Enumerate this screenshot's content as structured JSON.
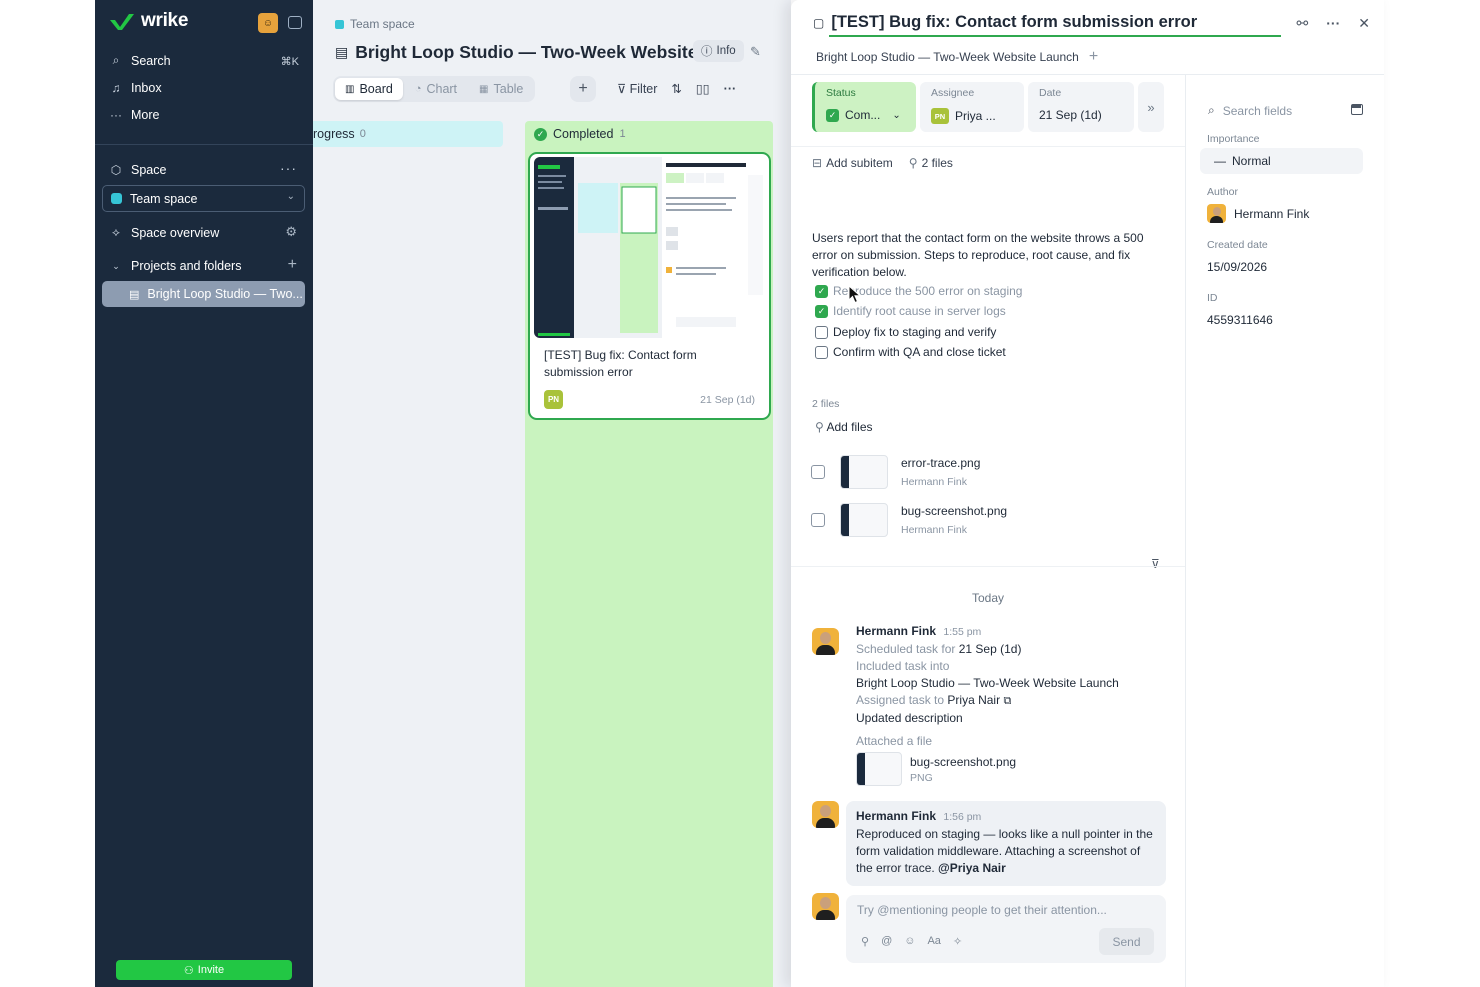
{
  "sidebar": {
    "brand": "wrike",
    "nav": [
      {
        "icon": "search-icon",
        "label": "Search",
        "shortcut": "⌘K"
      },
      {
        "icon": "bell-icon",
        "label": "Inbox"
      },
      {
        "icon": "ellipsis-icon",
        "label": "More"
      }
    ],
    "space_label": "Space",
    "team_space": "Team space",
    "space_overview": "Space overview",
    "projects_label": "Projects and folders",
    "project_item": "Bright Loop Studio — Two...",
    "invite": "Invite"
  },
  "main": {
    "breadcrumb": "Team space",
    "title": "Bright Loop Studio — Two-Week Website...",
    "info": "Info",
    "views": [
      {
        "label": "Board",
        "icon": "board-icon",
        "active": true
      },
      {
        "label": "Chart",
        "icon": "chart-icon",
        "active": false
      },
      {
        "label": "Table",
        "icon": "table-icon",
        "active": false
      }
    ],
    "filter": "Filter",
    "columns": {
      "in_progress": {
        "label": "rogress",
        "count": "0"
      },
      "completed": {
        "label": "Completed",
        "count": "1"
      }
    },
    "card": {
      "title": "[TEST] Bug fix: Contact form submission error",
      "assignee_initials": "PN",
      "date": "21 Sep (1d)"
    }
  },
  "task": {
    "title": "[TEST] Bug fix: Contact form submission error",
    "project": "Bright Loop Studio — Two-Week Website Launch",
    "fields": {
      "status_label": "Status",
      "status_value": "Com...",
      "assignee_label": "Assignee",
      "assignee_initials": "PN",
      "assignee_value": "Priya ...",
      "date_label": "Date",
      "date_value": "21 Sep (1d)"
    },
    "add_subitem": "Add subitem",
    "files_count": "2 files",
    "description": "Users report that the contact form on the website throws a 500 error on submission. Steps to reproduce, root cause, and fix verification below.",
    "checklist": [
      {
        "text": "Reproduce the 500 error on staging",
        "done": true
      },
      {
        "text": "Identify root cause in server logs",
        "done": true
      },
      {
        "text": "Deploy fix to staging and verify",
        "done": false
      },
      {
        "text": "Confirm with QA and close ticket",
        "done": false
      }
    ],
    "files_label": "2 files",
    "add_files": "Add files",
    "files": [
      {
        "name": "error-trace.png",
        "author": "Hermann Fink"
      },
      {
        "name": "bug-screenshot.png",
        "author": "Hermann Fink"
      }
    ],
    "activity": {
      "day": "Today",
      "entry1": {
        "author": "Hermann Fink",
        "time": "1:55 pm",
        "scheduled_prefix": "Scheduled task for",
        "scheduled_value": "21 Sep (1d)",
        "included": "Included task into",
        "project": "Bright Loop Studio — Two-Week Website Launch",
        "assigned_prefix": "Assigned task to",
        "assigned_value": "Priya Nair",
        "updated": "Updated description",
        "attached": "Attached a file",
        "file_name": "bug-screenshot.png",
        "file_type": "PNG"
      },
      "entry2": {
        "author": "Hermann Fink",
        "time": "1:56 pm",
        "text": "Reproduced on staging — looks like a null pointer in the form validation middleware. Attaching a screenshot of the error trace.",
        "mention": "@Priya Nair"
      }
    },
    "composer": {
      "placeholder": "Try @mentioning people to get their attention...",
      "send": "Send"
    },
    "side_fields": {
      "search_placeholder": "Search fields",
      "importance_label": "Importance",
      "importance_value": "Normal",
      "author_label": "Author",
      "author_value": "Hermann Fink",
      "created_label": "Created date",
      "created_value": "15/09/2026",
      "id_label": "ID",
      "id_value": "4559311646"
    }
  },
  "colors": {
    "sidebar": "#1b2a3d",
    "accent_green": "#2fa84f",
    "completed_column": "#c9f3bf",
    "progress_column": "#cef3f6",
    "invite": "#22c744"
  }
}
